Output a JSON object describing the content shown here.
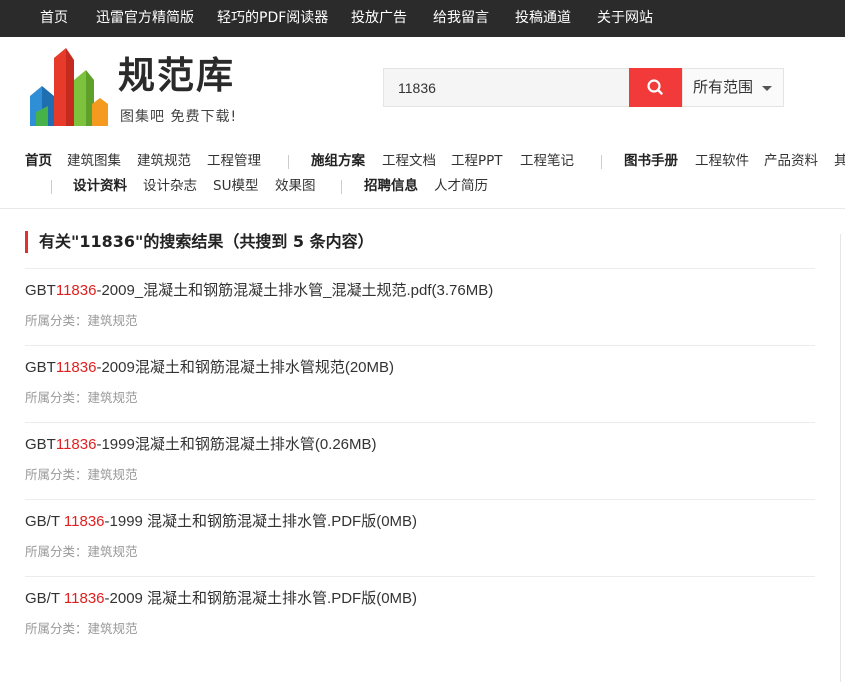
{
  "topnav": [
    "首页",
    "迅雷官方精简版",
    "轻巧的PDF阅读器",
    "投放广告",
    "给我留言",
    "投稿通道",
    "关于网站"
  ],
  "brand": {
    "name": "规范库",
    "slogan": "图集吧 免费下载!"
  },
  "search": {
    "value": "11836",
    "scope": "所有范围"
  },
  "catnav": {
    "row1": [
      "首页",
      "建筑图集",
      "建筑规范",
      "工程管理",
      "施组方案",
      "工程文档",
      "工程PPT",
      "工程笔记",
      "图书手册",
      "工程软件",
      "产品资料",
      "其"
    ],
    "row2": [
      "设计资料",
      "设计杂志",
      "SU模型",
      "效果图",
      "招聘信息",
      "人才简历"
    ]
  },
  "results": {
    "heading": "有关\"11836\"的搜索结果（共搜到 5 条内容）",
    "category_label": "所属分类：",
    "items": [
      {
        "pre": "GBT",
        "hl": "11836",
        "post": "-2009_混凝土和钢筋混凝土排水管_混凝土规范.pdf(3.76MB)",
        "category": "建筑规范"
      },
      {
        "pre": "GBT",
        "hl": "11836",
        "post": "-2009混凝土和钢筋混凝土排水管规范(20MB)",
        "category": "建筑规范"
      },
      {
        "pre": "GBT",
        "hl": "11836",
        "post": "-1999混凝土和钢筋混凝土排水管(0.26MB)",
        "category": "建筑规范"
      },
      {
        "pre": "GB/T ",
        "hl": "11836",
        "post": "-1999 混凝土和钢筋混凝土排水管.PDF版(0MB)",
        "category": "建筑规范"
      },
      {
        "pre": "GB/T ",
        "hl": "11836",
        "post": "-2009 混凝土和钢筋混凝土排水管.PDF版(0MB)",
        "category": "建筑规范"
      }
    ]
  },
  "colors": {
    "topbar": "#2b2b2b",
    "accent": "#f23a3a",
    "highlight": "#e02020"
  },
  "icons": {
    "search": "search-icon",
    "scope": "chevron-down-icon"
  }
}
